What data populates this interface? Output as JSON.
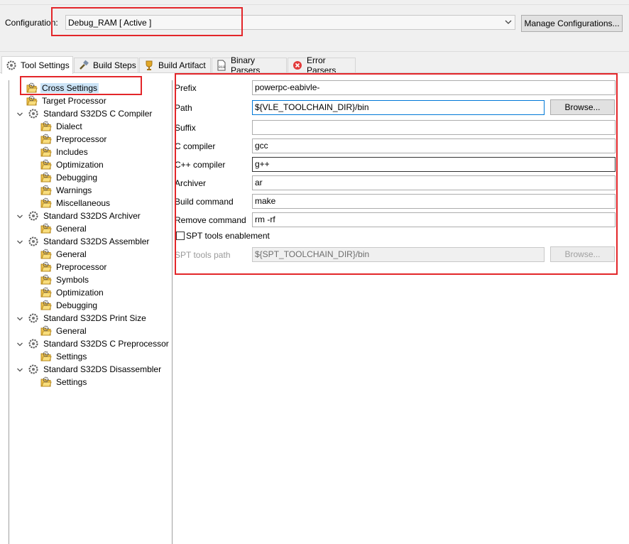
{
  "config": {
    "label": "Configuration:",
    "selected": "Debug_RAM  [ Active ]",
    "manage_button": "Manage Configurations..."
  },
  "tabs": [
    {
      "label": "Tool Settings",
      "icon": "tool-settings-icon"
    },
    {
      "label": "Build Steps",
      "icon": "build-steps-icon"
    },
    {
      "label": "Build Artifact",
      "icon": "build-artifact-icon"
    },
    {
      "label": "Binary Parsers",
      "icon": "binary-parsers-icon"
    },
    {
      "label": "Error Parsers",
      "icon": "error-parsers-icon"
    }
  ],
  "tree": [
    {
      "label": "Cross Settings"
    },
    {
      "label": "Target Processor"
    },
    {
      "label": "Standard S32DS C Compiler"
    },
    {
      "label": "Dialect"
    },
    {
      "label": "Preprocessor"
    },
    {
      "label": "Includes"
    },
    {
      "label": "Optimization"
    },
    {
      "label": "Debugging"
    },
    {
      "label": "Warnings"
    },
    {
      "label": "Miscellaneous"
    },
    {
      "label": "Standard S32DS Archiver"
    },
    {
      "label": "General"
    },
    {
      "label": "Standard S32DS Assembler"
    },
    {
      "label": "General"
    },
    {
      "label": "Preprocessor"
    },
    {
      "label": "Symbols"
    },
    {
      "label": "Optimization"
    },
    {
      "label": "Debugging"
    },
    {
      "label": "Standard S32DS Print Size"
    },
    {
      "label": "General"
    },
    {
      "label": "Standard S32DS C Preprocessor"
    },
    {
      "label": "Settings"
    },
    {
      "label": "Standard S32DS Disassembler"
    },
    {
      "label": "Settings"
    }
  ],
  "form": {
    "prefix": {
      "label": "Prefix",
      "value": "powerpc-eabivle-"
    },
    "path": {
      "label": "Path",
      "value": "${VLE_TOOLCHAIN_DIR}/bin",
      "browse": "Browse..."
    },
    "suffix": {
      "label": "Suffix",
      "value": ""
    },
    "c_compiler": {
      "label": "C compiler",
      "value": "gcc"
    },
    "cpp_compiler": {
      "label": "C++ compiler",
      "value": "g++"
    },
    "archiver": {
      "label": "Archiver",
      "value": "ar"
    },
    "build_command": {
      "label": "Build command",
      "value": "make"
    },
    "remove_command": {
      "label": "Remove command",
      "value": "rm -rf"
    },
    "spt_enable": {
      "label": "SPT tools enablement",
      "checked": false
    },
    "spt_path": {
      "label": "SPT tools path",
      "value": "${SPT_TOOLCHAIN_DIR}/bin",
      "browse": "Browse..."
    }
  },
  "colors": {
    "highlight_box": "#e3262a",
    "selection": "#cce4f7",
    "focus_border": "#0078d7"
  }
}
